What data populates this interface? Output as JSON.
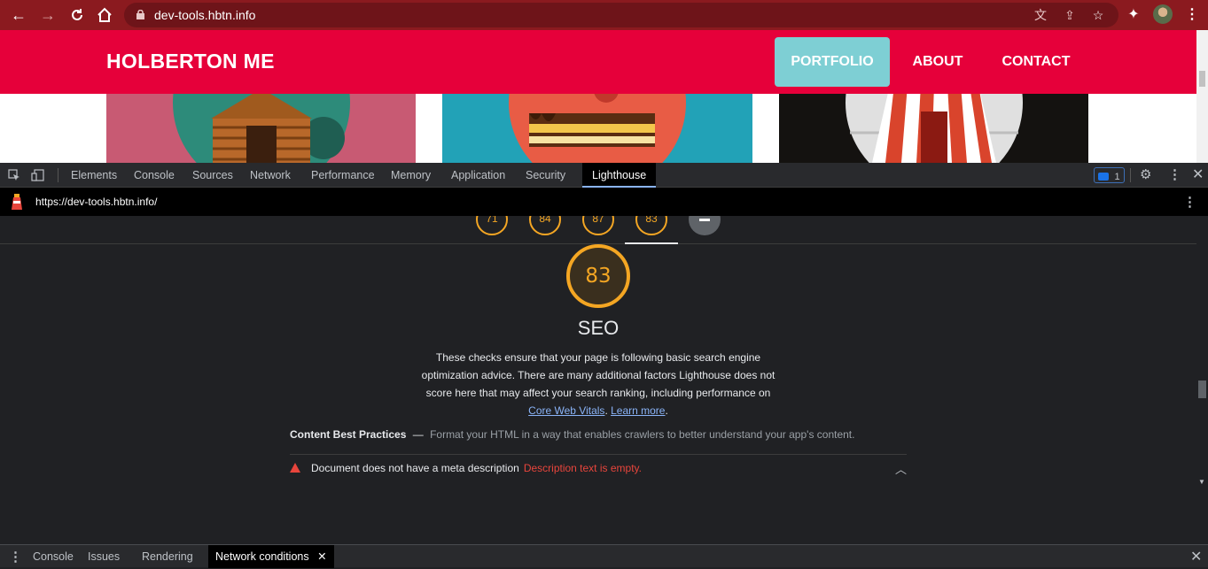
{
  "browser": {
    "url": "dev-tools.hbtn.info",
    "back_icon": "arrow-left",
    "forward_icon": "arrow-right",
    "reload_icon": "reload",
    "home_icon": "home"
  },
  "site": {
    "logo": "HOLBERTON ME",
    "nav": [
      "PORTFOLIO",
      "ABOUT",
      "CONTACT"
    ],
    "colors": {
      "header": "#e6003a",
      "active_nav": "#7ecfd4"
    }
  },
  "devtools": {
    "tabs": [
      "Elements",
      "Console",
      "Sources",
      "Network",
      "Performance",
      "Memory",
      "Application",
      "Security",
      "Lighthouse"
    ],
    "active_tab": "Lighthouse",
    "issues_count": "1",
    "lighthouse_url": "https://dev-tools.hbtn.info/"
  },
  "lighthouse": {
    "mini_scores": [
      "71",
      "84",
      "87",
      "83"
    ],
    "score": "83",
    "category": "SEO",
    "description_lines": [
      "These checks ensure that your page is following basic search engine",
      "optimization advice. There are many additional factors Lighthouse does not",
      "score here that may affect your search ranking, including performance on"
    ],
    "link_cwv": "Core Web Vitals",
    "link_sep": ". ",
    "link_learn": "Learn more",
    "link_end": ".",
    "group_title": "Content Best Practices",
    "group_dash": "—",
    "group_desc": "Format your HTML in a way that enables crawlers to better understand your app's content.",
    "audit_title": "Document does not have a meta description",
    "audit_display": "Description text is empty.",
    "colors": {
      "average": "#f4a623",
      "fail": "#e8453c",
      "link": "#8ab4f8"
    }
  },
  "drawer": {
    "tabs": [
      "Console",
      "Issues",
      "Rendering",
      "Network conditions"
    ],
    "active_tab": "Network conditions"
  }
}
